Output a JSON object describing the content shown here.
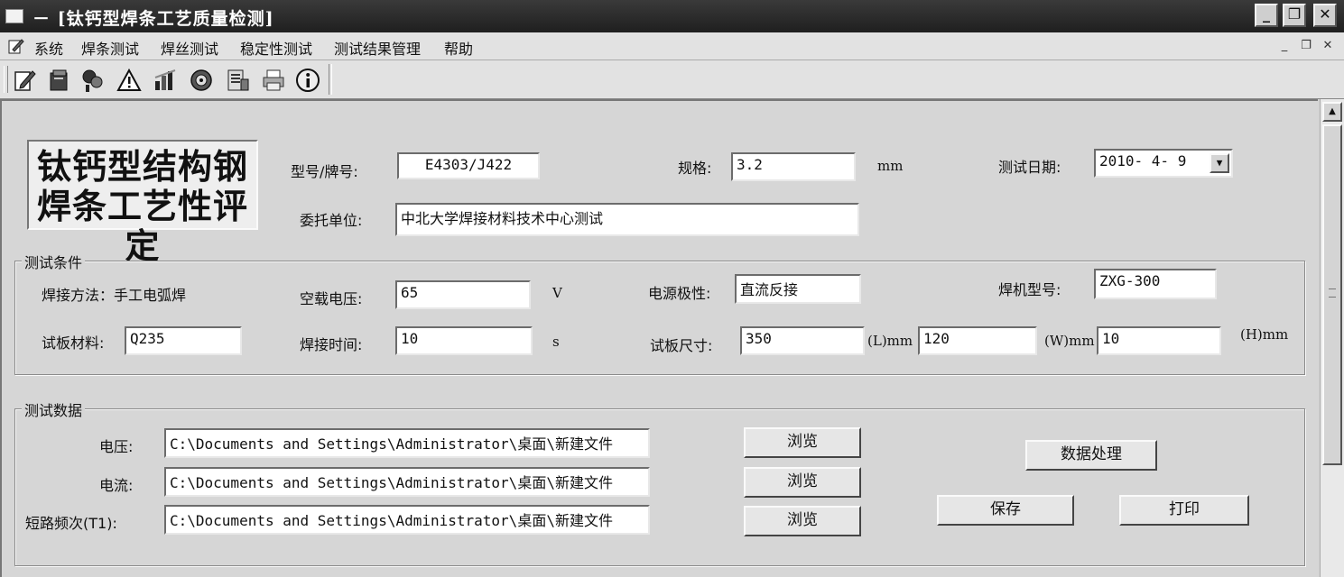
{
  "window": {
    "title": "－ [钛钙型焊条工艺质量检测]",
    "buttons": {
      "minimize": "_",
      "restore": "❐",
      "close": "✕"
    }
  },
  "menu": {
    "items": [
      "系统",
      "焊条测试",
      "焊丝测试",
      "稳定性测试",
      "测试结果管理",
      "帮助"
    ],
    "mdi_controls": {
      "minimize": "_",
      "restore": "❐",
      "close": "✕"
    }
  },
  "toolbar": {
    "icons": [
      "edit-icon",
      "notebook-icon",
      "probe-icon",
      "warning-icon",
      "chart-icon",
      "record-icon",
      "document-icon",
      "print-icon",
      "info-icon"
    ]
  },
  "banner": {
    "line1": "钛钙型结构钢",
    "line2": "焊条工艺性评定"
  },
  "header": {
    "model_label": "型号/牌号:",
    "model_value": "E4303/J422",
    "spec_label": "规格:",
    "spec_value": "3.2",
    "spec_unit": "mm",
    "date_label": "测试日期:",
    "date_value": "2010- 4- 9",
    "client_label": "委托单位:",
    "client_value": "中北大学焊接材料技术中心测试"
  },
  "conditions": {
    "title": "测试条件",
    "method": "焊接方法：手工电弧焊",
    "voltage_label": "空载电压:",
    "voltage_value": "65",
    "voltage_unit": "V",
    "polarity_label": "电源极性:",
    "polarity_value": "直流反接",
    "machine_label": "焊机型号:",
    "machine_value": "ZXG-300",
    "material_label": "试板材料:",
    "material_value": "Q235",
    "time_label": "焊接时间:",
    "time_value": "10",
    "time_unit": "s",
    "size_label": "试板尺寸:",
    "size_l": "350",
    "size_l_unit": "(L)mm",
    "size_w": "120",
    "size_w_unit": "(W)mm",
    "size_h": "10",
    "size_h_unit": "(H)mm"
  },
  "data": {
    "title": "测试数据",
    "rows": [
      {
        "label": "电压:",
        "path": "C:\\Documents and Settings\\Administrator\\桌面\\新建文件",
        "browse": "浏览"
      },
      {
        "label": "电流:",
        "path": "C:\\Documents and Settings\\Administrator\\桌面\\新建文件",
        "browse": "浏览"
      },
      {
        "label": "短路频次(T1):",
        "path": "C:\\Documents and Settings\\Administrator\\桌面\\新建文件",
        "browse": "浏览"
      }
    ],
    "process_button": "数据处理",
    "save_button": "保存",
    "print_button": "打印"
  },
  "scrollbar": {
    "up": "▲"
  }
}
